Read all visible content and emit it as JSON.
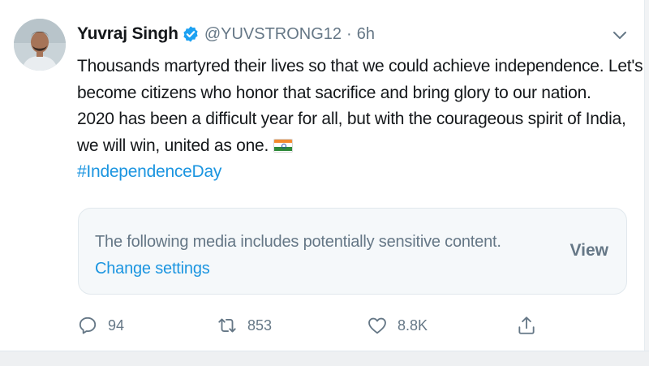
{
  "author": {
    "name": "Yuvraj Singh",
    "handle": "@YUVSTRONG12",
    "separator": "·",
    "time": "6h",
    "verified": true
  },
  "tweet": {
    "lines": [
      "Thousands martyred their lives so that we could achieve independence. Let's",
      "become citizens who honor that sacrifice and bring glory to our nation.",
      "2020 has been a difficult year for all, but with the courageous spirit of India,",
      "we will win, united as one."
    ],
    "emoji": "india-flag",
    "hashtag": "#IndependenceDay"
  },
  "media_warning": {
    "message": "The following media includes potentially sensitive content.",
    "change_settings_label": "Change settings",
    "view_label": "View"
  },
  "actions": {
    "reply_count": "94",
    "retweet_count": "853",
    "like_count": "8.8K"
  },
  "icons": {
    "verified": "verified-badge-icon",
    "caret": "chevron-down-icon",
    "reply": "reply-icon",
    "retweet": "retweet-icon",
    "like": "heart-icon",
    "share": "share-icon"
  },
  "colors": {
    "accent": "#1b95e0",
    "secondary_text": "#657786",
    "primary_text": "#14171a",
    "card_bg": "#f5f8fa"
  }
}
